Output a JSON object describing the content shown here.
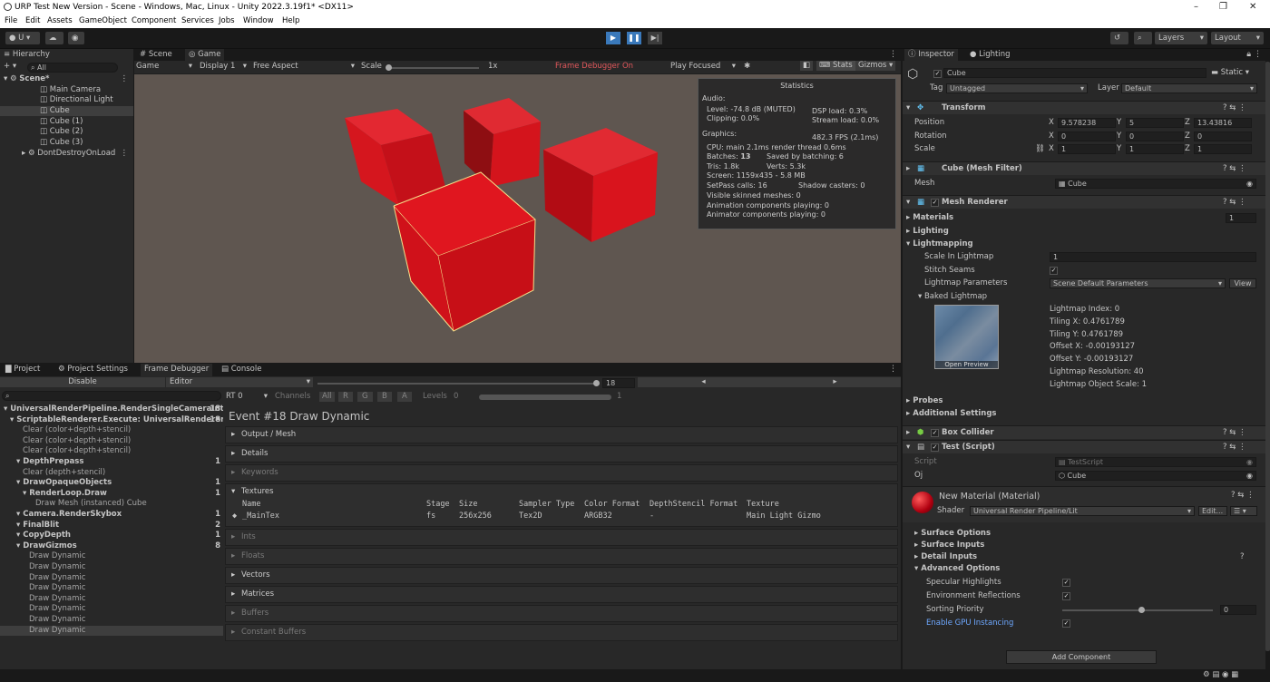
{
  "window": {
    "title": "URP Test New Version - Scene - Windows, Mac, Linux - Unity 2022.3.19f1* <DX11>",
    "min": "–",
    "max": "❐",
    "close": "✕"
  },
  "menu": [
    "File",
    "Edit",
    "Assets",
    "GameObject",
    "Component",
    "Services",
    "Jobs",
    "Window",
    "Help"
  ],
  "toolbar": {
    "account": "U ▾",
    "layers": "Layers",
    "layout": "Layout"
  },
  "hierarchy": {
    "tab": "Hierarchy",
    "search": "All",
    "scene": "Scene*",
    "items": [
      "Main Camera",
      "Directional Light",
      "Cube",
      "Cube (1)",
      "Cube (2)",
      "Cube (3)"
    ],
    "dont_destroy": "DontDestroyOnLoad"
  },
  "game": {
    "tabs": [
      "Scene",
      "Game"
    ],
    "mode": "Game",
    "display": "Display 1",
    "aspect": "Free Aspect",
    "scale_label": "Scale",
    "scale_value": "1x",
    "frame_debugger": "Frame Debugger On",
    "play_focused": "Play Focused",
    "stats": "Stats",
    "gizmos": "Gizmos"
  },
  "statistics": {
    "title": "Statistics",
    "audio_h": "Audio:",
    "level": "Level: -74.8 dB (MUTED)",
    "clipping": "Clipping: 0.0%",
    "dsp": "DSP load: 0.3%",
    "stream": "Stream load: 0.0%",
    "graphics_h": "Graphics:",
    "fps": "482.3 FPS (2.1ms)",
    "cpu": "CPU: main 2.1ms  render thread 0.6ms",
    "batches_label": "Batches: ",
    "batches": "13",
    "saved": "Saved by batching: 6",
    "tris": "Tris: 1.8k",
    "verts": "Verts: 5.3k",
    "screen": "Screen: 1159x435 - 5.8 MB",
    "setpass": "SetPass calls: 16",
    "shadow": "Shadow casters: 0",
    "skinned": "Visible skinned meshes: 0",
    "anim": "Animation components playing: 0",
    "animator": "Animator components playing: 0"
  },
  "bottom_tabs": [
    "Project",
    "Project Settings",
    "Frame Debugger",
    "Console"
  ],
  "frame_debugger": {
    "disable": "Disable",
    "editor": "Editor",
    "event_count": "18",
    "rt": "RT 0",
    "channels": "Channels",
    "ch": [
      "All",
      "R",
      "G",
      "B",
      "A"
    ],
    "levels": "Levels",
    "level_min": "0",
    "level_max": "1",
    "event_title": "Event #18 Draw Dynamic",
    "tree": [
      {
        "t": "UniversalRenderPipeline.RenderSingleCameraInter",
        "n": "18",
        "i": 0,
        "b": true
      },
      {
        "t": "ScriptableRenderer.Execute: UniversalRenderer",
        "n": "18",
        "i": 1,
        "b": true
      },
      {
        "t": "Clear (color+depth+stencil)",
        "n": "",
        "i": 3,
        "b": false
      },
      {
        "t": "Clear (color+depth+stencil)",
        "n": "",
        "i": 3,
        "b": false
      },
      {
        "t": "Clear (color+depth+stencil)",
        "n": "",
        "i": 3,
        "b": false
      },
      {
        "t": "DepthPrepass",
        "n": "1",
        "i": 2,
        "b": true
      },
      {
        "t": "Clear (depth+stencil)",
        "n": "",
        "i": 3,
        "b": false
      },
      {
        "t": "DrawOpaqueObjects",
        "n": "1",
        "i": 2,
        "b": true
      },
      {
        "t": "RenderLoop.Draw",
        "n": "1",
        "i": 3,
        "b": true
      },
      {
        "t": "Draw Mesh (instanced) Cube",
        "n": "",
        "i": 5,
        "b": false
      },
      {
        "t": "Camera.RenderSkybox",
        "n": "1",
        "i": 2,
        "b": true
      },
      {
        "t": "FinalBlit",
        "n": "2",
        "i": 2,
        "b": true
      },
      {
        "t": "CopyDepth",
        "n": "1",
        "i": 2,
        "b": true
      },
      {
        "t": "DrawGizmos",
        "n": "8",
        "i": 2,
        "b": true
      },
      {
        "t": "Draw Dynamic",
        "n": "",
        "i": 4,
        "b": false
      },
      {
        "t": "Draw Dynamic",
        "n": "",
        "i": 4,
        "b": false
      },
      {
        "t": "Draw Dynamic",
        "n": "",
        "i": 4,
        "b": false
      },
      {
        "t": "Draw Dynamic",
        "n": "",
        "i": 4,
        "b": false
      },
      {
        "t": "Draw Dynamic",
        "n": "",
        "i": 4,
        "b": false
      },
      {
        "t": "Draw Dynamic",
        "n": "",
        "i": 4,
        "b": false
      },
      {
        "t": "Draw Dynamic",
        "n": "",
        "i": 4,
        "b": false
      },
      {
        "t": "Draw Dynamic",
        "n": "",
        "i": 4,
        "b": false
      }
    ],
    "sections": {
      "output": "Output / Mesh",
      "details": "Details",
      "keywords": "Keywords",
      "textures": "Textures",
      "ints": "Ints",
      "floats": "Floats",
      "vectors": "Vectors",
      "matrices": "Matrices",
      "buffers": "Buffers",
      "cbuffers": "Constant Buffers"
    },
    "tex_headers": [
      "Name",
      "Stage",
      "Size",
      "Sampler Type",
      "Color Format",
      "DepthStencil Format",
      "Texture"
    ],
    "tex_row": [
      "_MainTex",
      "fs",
      "256x256",
      "Tex2D",
      "ARGB32",
      "-",
      "Main Light Gizmo"
    ]
  },
  "inspector": {
    "tabs": [
      "Inspector",
      "Lighting"
    ],
    "name": "Cube",
    "static": "Static",
    "tag_label": "Tag",
    "tag": "Untagged",
    "layer_label": "Layer",
    "layer": "Default",
    "transform": {
      "title": "Transform",
      "position": "Position",
      "rotation": "Rotation",
      "scale": "Scale",
      "px": "9.578238",
      "py": "5",
      "pz": "13.43816",
      "rx": "0",
      "ry": "0",
      "rz": "0",
      "sx": "1",
      "sy": "1",
      "sz": "1",
      "x": "X",
      "y": "Y",
      "z": "Z"
    },
    "mesh_filter": {
      "title": "Cube (Mesh Filter)",
      "mesh_label": "Mesh",
      "mesh": "Cube"
    },
    "mesh_renderer": {
      "title": "Mesh Renderer",
      "materials": "Materials",
      "mat_count": "1",
      "lighting": "Lighting",
      "lightmapping": "Lightmapping",
      "scale_in_lm": "Scale In Lightmap",
      "scale_val": "1",
      "stitch": "Stitch Seams",
      "lm_params": "Lightmap Parameters",
      "lm_params_val": "Scene Default Parameters",
      "view": "View",
      "baked": "Baked Lightmap",
      "open_preview": "Open Preview",
      "lm_index": "Lightmap Index: 0",
      "tiling_x": "Tiling X: 0.4761789",
      "tiling_y": "Tiling Y: 0.4761789",
      "offset_x": "Offset X: -0.00193127",
      "offset_y": "Offset Y: -0.00193127",
      "lm_res": "Lightmap Resolution: 40",
      "lm_scale": "Lightmap Object Scale: 1",
      "probes": "Probes",
      "additional": "Additional Settings"
    },
    "box_collider": {
      "title": "Box Collider"
    },
    "test_script": {
      "title": "Test (Script)",
      "script_label": "Script",
      "script": "TestScript",
      "oj_label": "Oj",
      "oj": "Cube"
    },
    "material": {
      "title": "New Material (Material)",
      "shader_label": "Shader",
      "shader": "Universal Render Pipeline/Lit",
      "edit": "Edit...",
      "surface_options": "Surface Options",
      "surface_inputs": "Surface Inputs",
      "detail_inputs": "Detail Inputs",
      "advanced": "Advanced Options",
      "specular": "Specular Highlights",
      "env_refl": "Environment Reflections",
      "sorting": "Sorting Priority",
      "sorting_val": "0",
      "gpu_inst": "Enable GPU Instancing"
    },
    "add_component": "Add Component"
  },
  "colors": {
    "cube": "#e0141c",
    "scene_bg": "#5f5650",
    "accent": "#3a79bb"
  }
}
